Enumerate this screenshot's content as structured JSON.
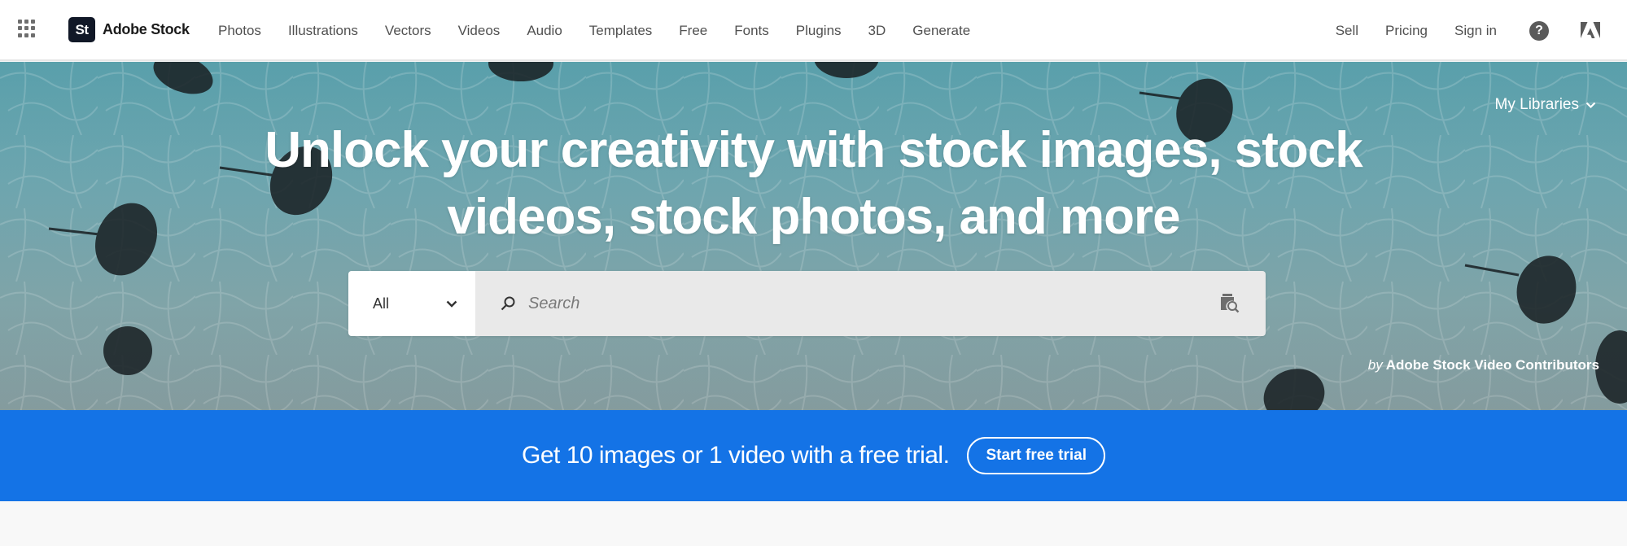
{
  "nav": {
    "apps_icon": "app-grid-icon",
    "logo_mark": "St",
    "logo_text": "Adobe Stock",
    "links": [
      "Photos",
      "Illustrations",
      "Vectors",
      "Videos",
      "Audio",
      "Templates",
      "Free",
      "Fonts",
      "Plugins",
      "3D",
      "Generate"
    ],
    "right_links": [
      "Sell",
      "Pricing",
      "Sign in"
    ],
    "help_icon": "help-icon",
    "help_glyph": "?",
    "adobe_icon": "adobe-logo-icon"
  },
  "hero": {
    "title_line1": "Unlock your creativity with stock images, stock",
    "title_line2": "videos, stock photos, and more",
    "libraries_label": "My Libraries",
    "search": {
      "type_value": "All",
      "placeholder": "Search",
      "value": ""
    },
    "credit_prefix": "by",
    "credit_name": "Adobe Stock Video Contributors"
  },
  "banner": {
    "text": "Get 10 images or 1 video with a free trial.",
    "button_label": "Start free trial",
    "color": "#1473e6"
  }
}
